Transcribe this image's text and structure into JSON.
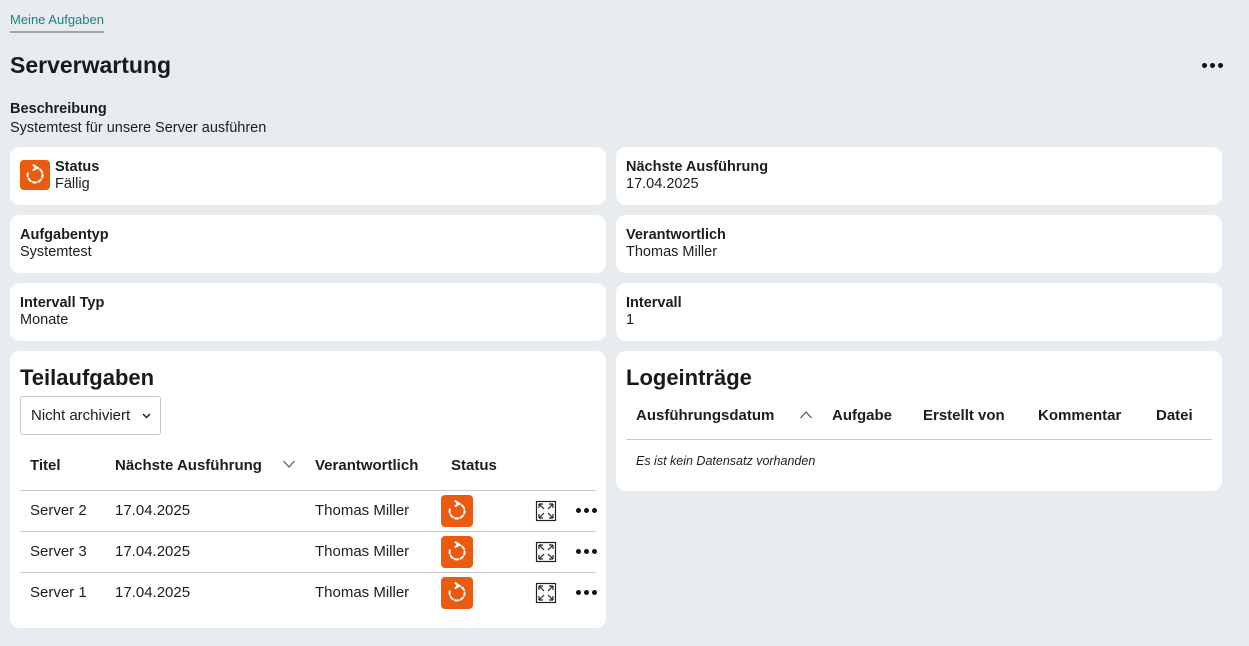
{
  "breadcrumb": "Meine Aufgaben",
  "title": "Serverwartung",
  "description": {
    "label": "Beschreibung",
    "value": "Systemtest für unsere Server ausführen"
  },
  "fields": {
    "status": {
      "label": "Status",
      "value": "Fällig"
    },
    "next_run": {
      "label": "Nächste Ausführung",
      "value": "17.04.2025"
    },
    "task_type": {
      "label": "Aufgabentyp",
      "value": "Systemtest"
    },
    "responsible": {
      "label": "Verantwortlich",
      "value": "Thomas Miller"
    },
    "interval_type": {
      "label": "Intervall Typ",
      "value": "Monate"
    },
    "interval": {
      "label": "Intervall",
      "value": "1"
    }
  },
  "subtasks": {
    "title": "Teilaufgaben",
    "filter": "Nicht archiviert",
    "columns": [
      "Titel",
      "Nächste Ausführung",
      "Verantwortlich",
      "Status"
    ],
    "rows": [
      {
        "title": "Server 2",
        "next": "17.04.2025",
        "responsible": "Thomas Miller"
      },
      {
        "title": "Server 3",
        "next": "17.04.2025",
        "responsible": "Thomas Miller"
      },
      {
        "title": "Server 1",
        "next": "17.04.2025",
        "responsible": "Thomas Miller"
      }
    ]
  },
  "log": {
    "title": "Logeinträge",
    "columns": [
      "Ausführungsdatum",
      "Aufgabe",
      "Erstellt von",
      "Kommentar",
      "Datei"
    ],
    "empty": "Es ist kein Datensatz vorhanden"
  },
  "colors": {
    "accent": "#e95b0e",
    "link": "#1c7f86",
    "background": "#e8ecef"
  },
  "icons": [
    "more-icon",
    "refresh-status-icon",
    "chevron-down-icon",
    "sort-down-icon",
    "sort-up-icon",
    "expand-icon"
  ]
}
